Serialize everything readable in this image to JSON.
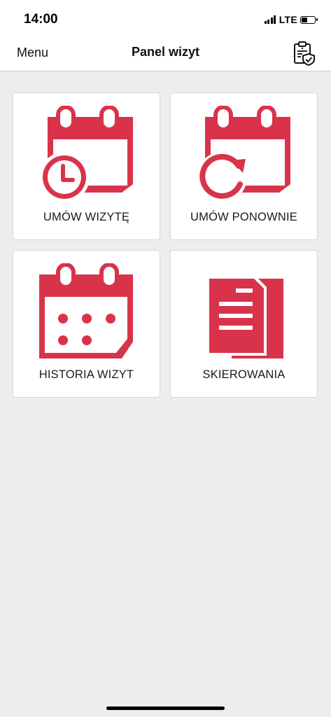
{
  "status_bar": {
    "time": "14:00",
    "network": "LTE",
    "battery_level": 0.45
  },
  "nav": {
    "menu_label": "Menu",
    "title": "Panel wizyt",
    "action_icon": "clipboard-shield-icon"
  },
  "tiles": [
    {
      "label": "UMÓW WIZYTĘ",
      "icon": "calendar-clock-icon"
    },
    {
      "label": "UMÓW PONOWNIE",
      "icon": "calendar-refresh-icon"
    },
    {
      "label": "HISTORIA WIZYT",
      "icon": "calendar-dots-icon"
    },
    {
      "label": "SKIEROWANIA",
      "icon": "documents-icon"
    }
  ],
  "colors": {
    "accent": "#d9334b",
    "background": "#ededed",
    "tile": "#ffffff",
    "header": "#ffffff"
  }
}
